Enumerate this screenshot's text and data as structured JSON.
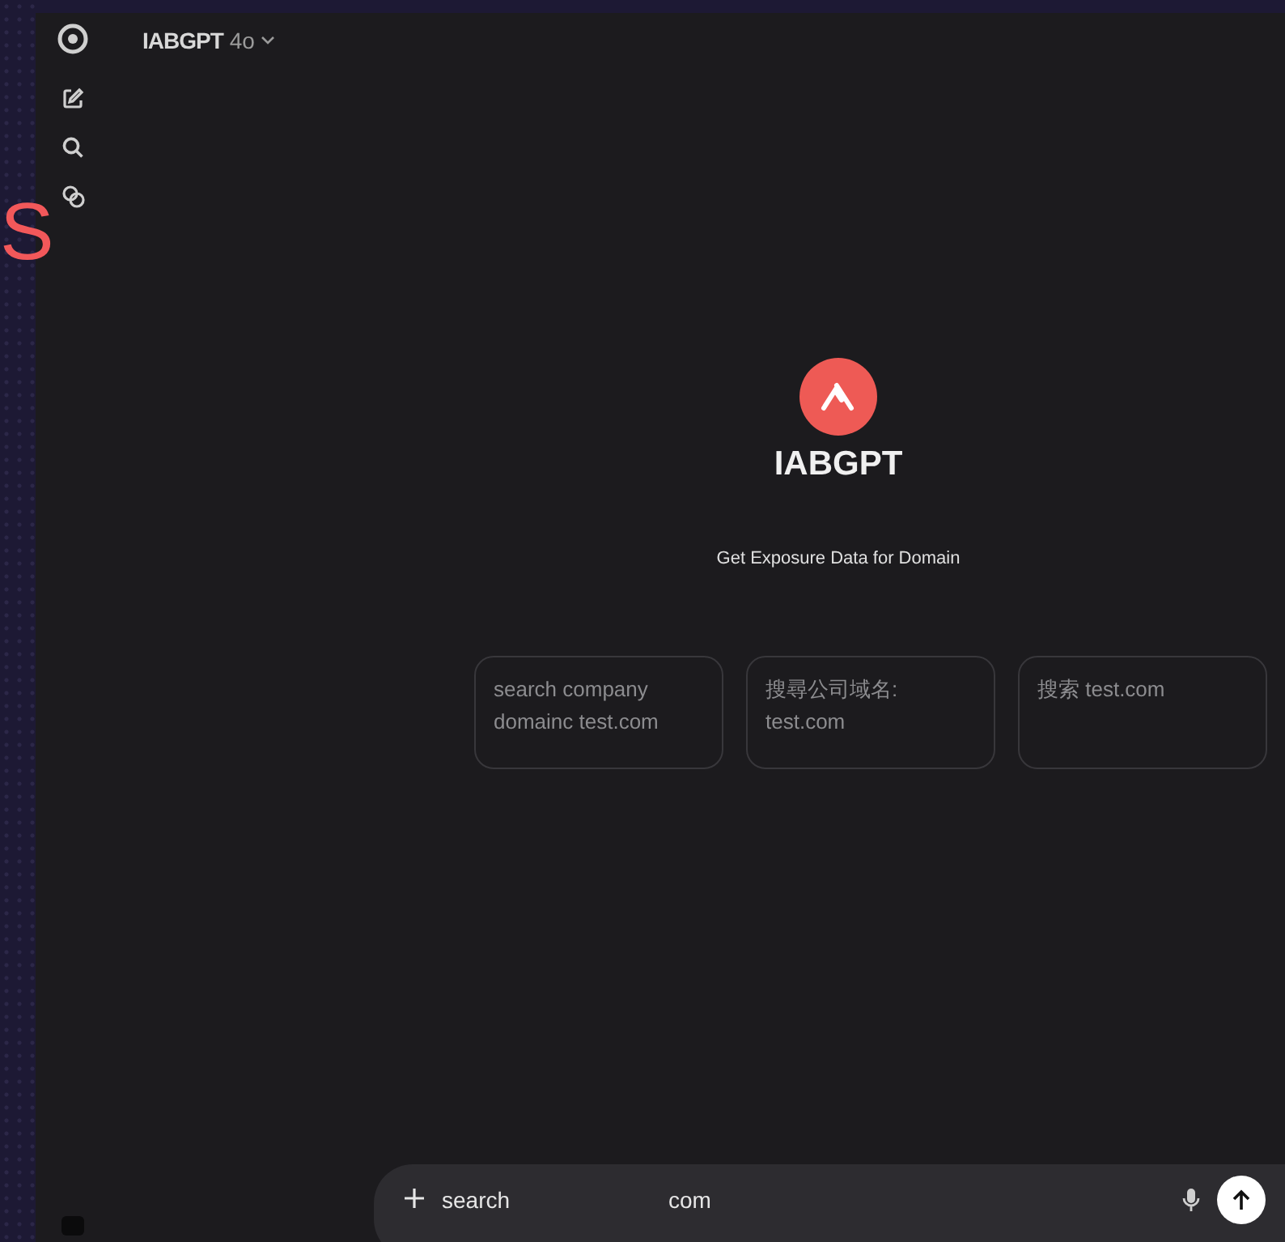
{
  "backdrop": {
    "letter": "S"
  },
  "header": {
    "model": "IABGPT",
    "version": "4o"
  },
  "hero": {
    "title": "IABGPT",
    "subtitle": "Get Exposure Data for Domain"
  },
  "suggestions": [
    {
      "text": "search company domainc test.com"
    },
    {
      "text": "搜尋公司域名: test.com"
    },
    {
      "text": "搜索 test.com"
    }
  ],
  "composer": {
    "value": "search",
    "value_tail": "com"
  }
}
